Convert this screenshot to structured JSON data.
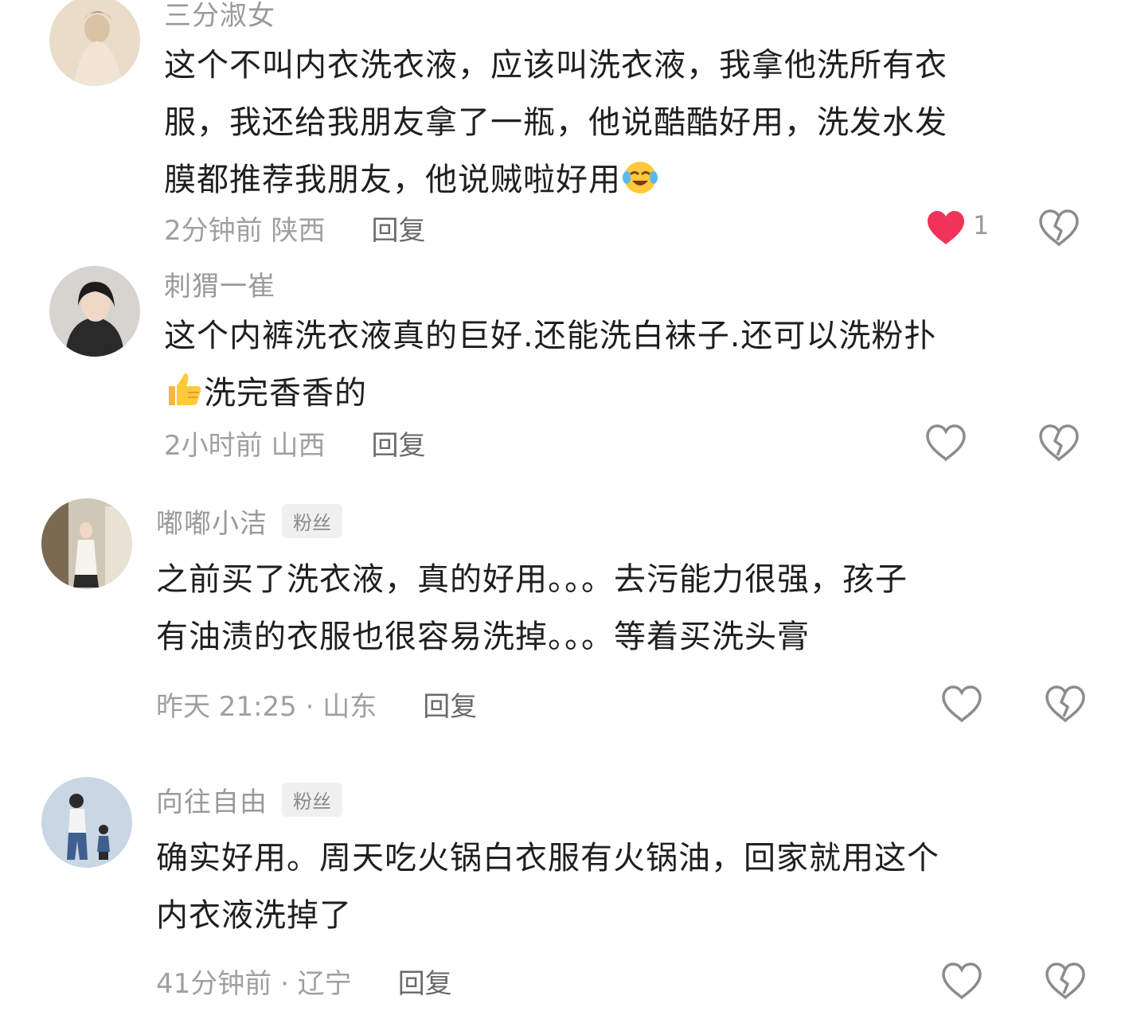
{
  "comments": [
    {
      "username": "三分淑女",
      "text_line1": "这个不叫内衣洗衣液，应该叫洗衣液，我拿他洗所有衣",
      "text_line2": "服，我还给我朋友拿了一瓶，他说酷酷好用，洗发水发",
      "text_line3": "膜都推荐我朋友，他说贼啦好用",
      "emoji": "laugh-crying-emoji",
      "meta": "2分钟前 陕西",
      "reply": "回复",
      "like_count": "1",
      "liked": true
    },
    {
      "username": "刺猬一崔",
      "text_line1": "这个内裤洗衣液真的巨好.还能洗白袜子.还可以洗粉扑",
      "text_line2": "洗完香香的",
      "emoji": "thumbs-up-emoji",
      "meta": "2小时前 山西",
      "reply": "回复",
      "liked": false
    },
    {
      "username": "嘟嘟小洁",
      "badge": "粉丝",
      "text_line1": "之前买了洗衣液，真的好用。。。去污能力很强，孩子",
      "text_line2": "有油渍的衣服也很容易洗掉。。。等着买洗头膏",
      "meta": "昨天 21:25 · 山东",
      "reply": "回复",
      "liked": false
    },
    {
      "username": "向往自由",
      "badge": "粉丝",
      "text_line1": "确实好用。周天吃火锅白衣服有火锅油，回家就用这个",
      "text_line2": "内衣液洗掉了",
      "meta": "41分钟前 · 辽宁",
      "reply": "回复",
      "liked": false
    }
  ],
  "colors": {
    "liked_heart": "#f0335a",
    "icon_outline": "#8c8c8c",
    "meta_text": "#a0a0a0",
    "username": "#9a9a9a",
    "badge_bg": "#f0f0f0"
  }
}
